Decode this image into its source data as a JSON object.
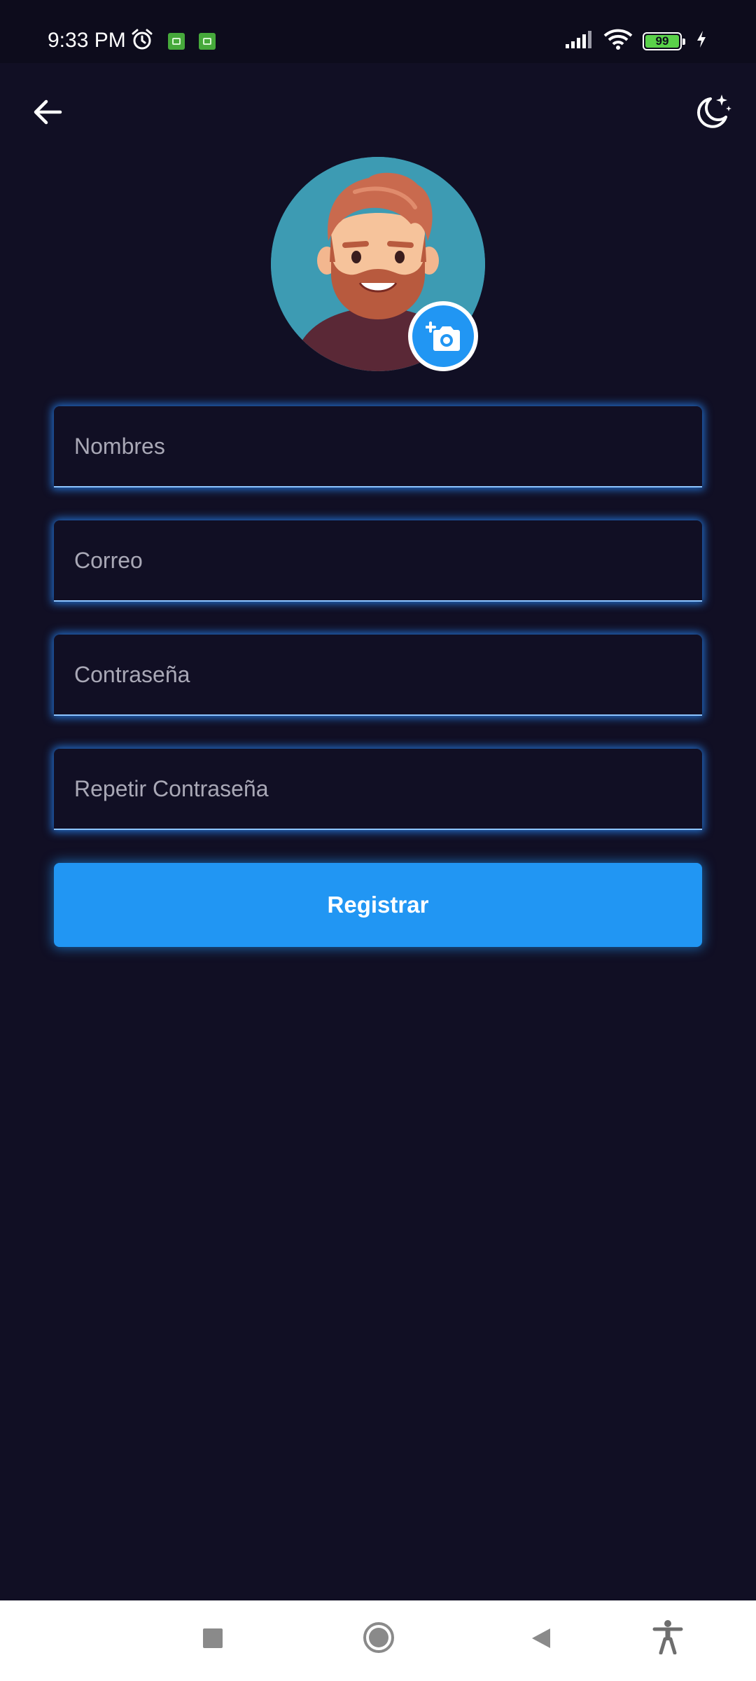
{
  "status_bar": {
    "time": "9:33 PM",
    "battery_level": "99",
    "icons": [
      "alarm-icon",
      "app-notification-icon",
      "app-notification-icon",
      "signal-icon",
      "wifi-icon",
      "battery-icon",
      "charging-icon"
    ]
  },
  "top_bar": {
    "back_icon": "arrow-left-icon",
    "theme_icon": "moon-stars-icon"
  },
  "avatar": {
    "image": "bearded-man-avatar",
    "edit_icon": "add-photo-camera-icon"
  },
  "form": {
    "fields": [
      {
        "placeholder": "Nombres",
        "value": ""
      },
      {
        "placeholder": "Correo",
        "value": ""
      },
      {
        "placeholder": "Contraseña",
        "value": ""
      },
      {
        "placeholder": "Repetir Contraseña",
        "value": ""
      }
    ],
    "submit_label": "Registrar"
  },
  "nav_bar": {
    "icons": [
      "recents-square-icon",
      "home-circle-icon",
      "back-triangle-icon",
      "accessibility-icon"
    ]
  },
  "colors": {
    "background": "#110f24",
    "accent": "#2196f3",
    "field_glow": "#288cff",
    "placeholder": "#a9a8b6"
  }
}
